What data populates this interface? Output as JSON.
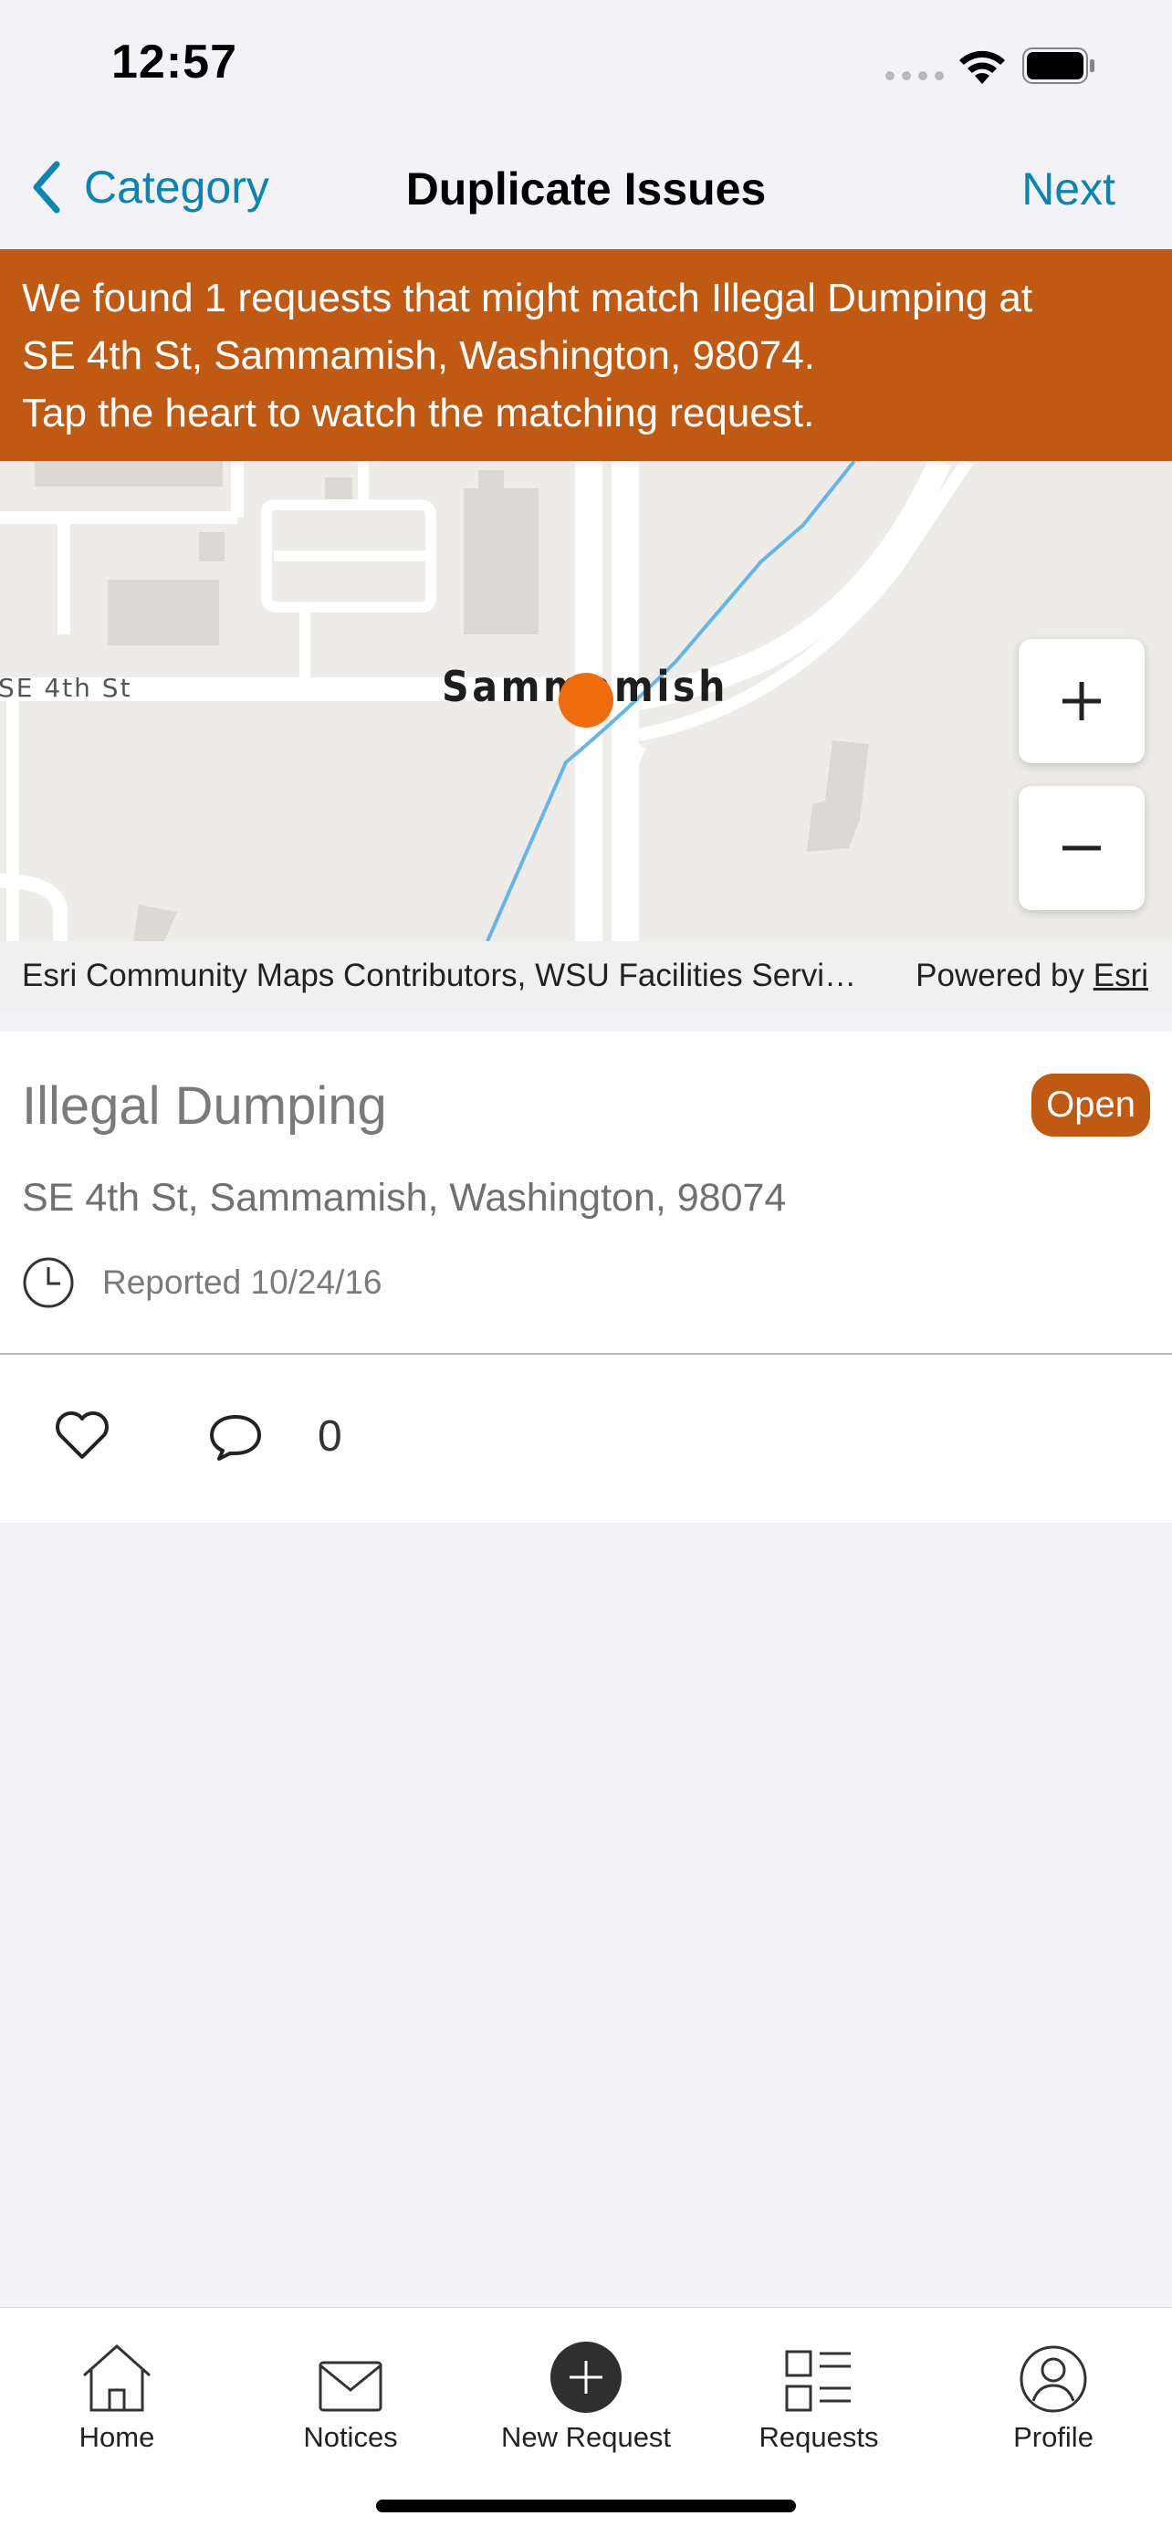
{
  "status_bar": {
    "time": "12:57"
  },
  "nav": {
    "back_label": "Category",
    "title": "Duplicate Issues",
    "next_label": "Next"
  },
  "banner": {
    "line1": "We found 1 requests that might match Illegal Dumping at",
    "line2": "SE 4th St, Sammamish, Washington, 98074.",
    "line3": "Tap the heart to watch the matching request."
  },
  "map": {
    "street_label": "SE 4th St",
    "place_label": "Sammamish",
    "marker_color": "#ef6c0c",
    "zoom_in_label": "+",
    "zoom_out_label": "−",
    "attribution": "Esri Community Maps Contributors, WSU Facilities Servi…",
    "powered_by": "Powered by",
    "powered_link": "Esri"
  },
  "request": {
    "title": "Illegal Dumping",
    "status": "Open",
    "address": "SE 4th St, Sammamish, Washington, 98074",
    "reported": "Reported 10/24/16",
    "comment_count": "0"
  },
  "tabs": [
    {
      "label": "Home",
      "icon": "home-icon"
    },
    {
      "label": "Notices",
      "icon": "envelope-icon"
    },
    {
      "label": "New Request",
      "icon": "plus-circle-icon"
    },
    {
      "label": "Requests",
      "icon": "list-icon"
    },
    {
      "label": "Profile",
      "icon": "person-icon"
    }
  ],
  "colors": {
    "accent": "#0a84b0",
    "brand": "#c05912",
    "marker": "#ef6c0c"
  }
}
